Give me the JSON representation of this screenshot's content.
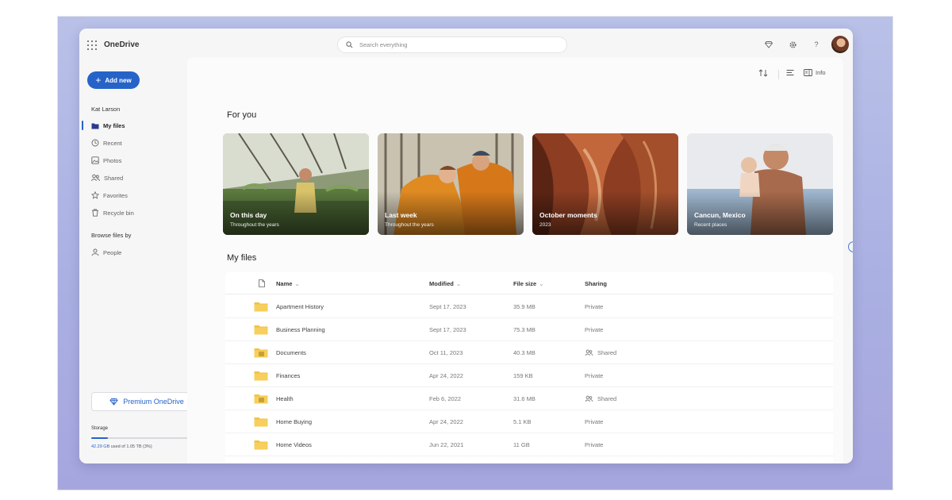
{
  "app": {
    "title": "OneDrive"
  },
  "search": {
    "placeholder": "Search everything"
  },
  "toolbar": {
    "info_label": "Info"
  },
  "sidebar": {
    "add_new_label": "Add new",
    "user_name": "Kat Larson",
    "items": [
      {
        "label": "My files",
        "icon": "folder-icon",
        "active": true
      },
      {
        "label": "Recent",
        "icon": "clock-icon",
        "active": false
      },
      {
        "label": "Photos",
        "icon": "image-icon",
        "active": false
      },
      {
        "label": "Shared",
        "icon": "people-icon",
        "active": false
      },
      {
        "label": "Favorites",
        "icon": "star-icon",
        "active": false
      },
      {
        "label": "Recycle bin",
        "icon": "trash-icon",
        "active": false
      }
    ],
    "browse_heading": "Browse files by",
    "browse_items": [
      {
        "label": "People",
        "icon": "person-icon"
      }
    ],
    "premium_label": "Premium OneDrive",
    "storage_label": "Storage",
    "storage_used": "42.29 GB",
    "storage_rest": "used of 1.05 TB (3%)",
    "storage_fraction": 0.03
  },
  "for_you": {
    "heading": "For you",
    "cards": [
      {
        "title": "On this day",
        "subtitle": "Throughout the years"
      },
      {
        "title": "Last week",
        "subtitle": "Throughout the years"
      },
      {
        "title": "October moments",
        "subtitle": "2023"
      },
      {
        "title": "Cancun, Mexico",
        "subtitle": "Recent places"
      }
    ]
  },
  "my_files": {
    "heading": "My files",
    "columns": {
      "name": "Name",
      "modified": "Modified",
      "size": "File size",
      "sharing": "Sharing"
    },
    "rows": [
      {
        "name": "Apartment History",
        "modified": "Sept 17, 2023",
        "size": "35.9 MB",
        "sharing": "Private",
        "shared": false
      },
      {
        "name": "Business Planning",
        "modified": "Sept 17, 2023",
        "size": "75.3 MB",
        "sharing": "Private",
        "shared": false
      },
      {
        "name": "Documents",
        "modified": "Oct 11, 2023",
        "size": "40.3 MB",
        "sharing": "Shared",
        "shared": true
      },
      {
        "name": "Finances",
        "modified": "Apr 24, 2022",
        "size": "159 KB",
        "sharing": "Private",
        "shared": false
      },
      {
        "name": "Health",
        "modified": "Feb 6, 2022",
        "size": "31.6 MB",
        "sharing": "Shared",
        "shared": true
      },
      {
        "name": "Home Buying",
        "modified": "Apr 24, 2022",
        "size": "5.1 KB",
        "sharing": "Private",
        "shared": false
      },
      {
        "name": "Home Videos",
        "modified": "Jun 22, 2021",
        "size": "11 GB",
        "sharing": "Private",
        "shared": false
      }
    ]
  },
  "colors": {
    "accent": "#2563c9",
    "folder": "#f2c244",
    "backdrop": "#aab0e2"
  }
}
